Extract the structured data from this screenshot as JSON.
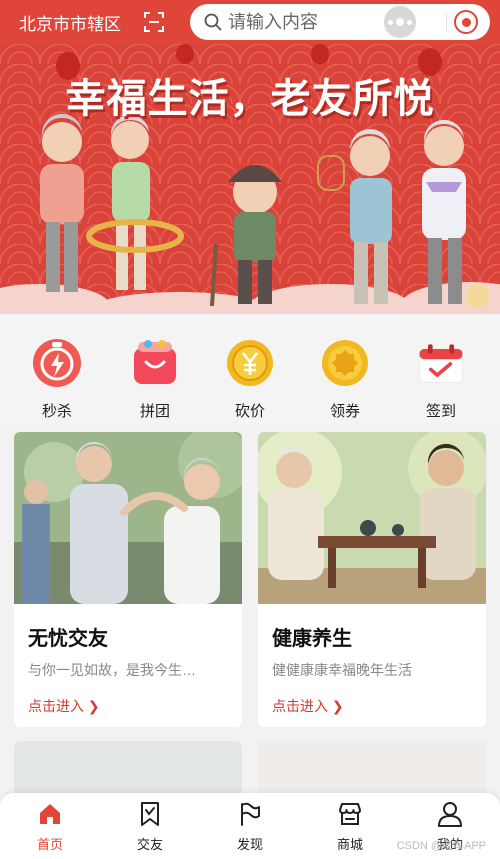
{
  "colors": {
    "brand": "#e0453a",
    "link": "#d23b2f",
    "text": "#222222",
    "muted": "#888888"
  },
  "header": {
    "city": "北京市市辖区",
    "search_placeholder": "请输入内容"
  },
  "banner": {
    "title": "幸福生活，老友所悦"
  },
  "categories": [
    {
      "label": "秒杀",
      "icon": "flash-sale-icon"
    },
    {
      "label": "拼团",
      "icon": "group-buy-bag-icon"
    },
    {
      "label": "砍价",
      "icon": "yen-coin-icon"
    },
    {
      "label": "领券",
      "icon": "coupon-coin-icon"
    },
    {
      "label": "签到",
      "icon": "calendar-checkin-icon"
    }
  ],
  "cards": [
    {
      "title": "无忧交友",
      "desc": "与你一见如故，是我今生…",
      "link": "点击进入"
    },
    {
      "title": "健康养生",
      "desc": "健健康康幸福晚年生活",
      "link": "点击进入"
    }
  ],
  "tabbar": [
    {
      "label": "首页",
      "icon": "home-icon",
      "active": true
    },
    {
      "label": "交友",
      "icon": "bookmark-icon",
      "active": false
    },
    {
      "label": "发现",
      "icon": "flag-icon",
      "active": false
    },
    {
      "label": "商城",
      "icon": "store-icon",
      "active": false
    },
    {
      "label": "我的",
      "icon": "user-icon",
      "active": false
    }
  ],
  "watermark": "CSDN @老年APP"
}
